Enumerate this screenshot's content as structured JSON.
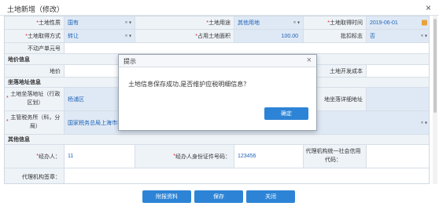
{
  "window": {
    "title": "土地新增（修改）",
    "close": "×"
  },
  "row1": {
    "l1": "*土地性质",
    "v1": "国有",
    "l2": "*土地用途",
    "v2": "其他用地",
    "l3": "*土地取得时间",
    "v3": "2019-06-01"
  },
  "row2": {
    "l1": "*土地取得方式",
    "v1": "转让",
    "l2": "*占用土地面积",
    "v2": "100.00",
    "l3": "批扣标志",
    "v3": "否"
  },
  "row3": {
    "l1": "不动产单元号"
  },
  "section_price": "地价信息",
  "row_price": {
    "l1": "地价",
    "l3": "土地开发成本"
  },
  "section_addr": "坐落地址信息",
  "row_addr": {
    "l1": "*土地坐落地址（行政区划）",
    "v1": "杨浦区",
    "l3": "地坐落详细地址"
  },
  "row_tax": {
    "l1": "*主管税务所（科，分局）",
    "v1": "国家税务总局上海市杨浦..."
  },
  "section_other": "其他信息",
  "row_agent": {
    "l1": "*经办人：",
    "v1": "11",
    "l2": "*经办人身份证件号码：",
    "v2": "123456",
    "l3": "代理机构统一社会信用代码："
  },
  "row_agent_sign": {
    "l1": "代理机构签章："
  },
  "dropdown_marks": {
    "clear": "×",
    "arrow": "▾"
  },
  "buttons": {
    "attach": "附报资料",
    "save": "保存",
    "close": "关闭"
  },
  "dialog": {
    "title": "提示",
    "close": "×",
    "message": "土地信息保存成功,是否维护应税明细信息？",
    "ok": "确定"
  },
  "colors": {
    "primary": "#2d84d6",
    "link": "#1e63b8",
    "required": "#e02020"
  }
}
